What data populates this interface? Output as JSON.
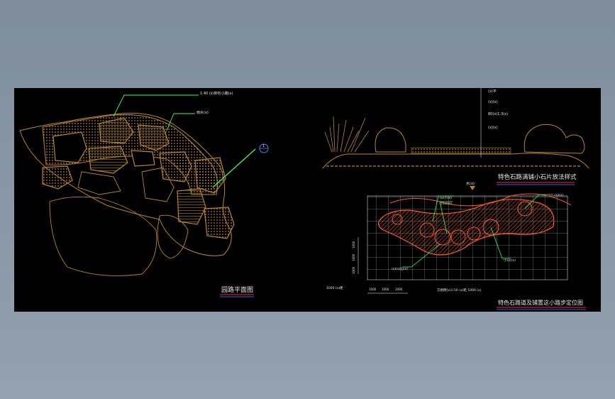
{
  "colors": {
    "background": "#000000",
    "plan_stroke": "#b8862a",
    "path_red": "#ff5a2a",
    "leader_green": "#39ff4a",
    "grid": "#ffffff",
    "title_underline_red": "#ff2a2a",
    "title_underline_blue": "#3a5bff",
    "text": "#e8e8e8"
  },
  "left_plan": {
    "title": "园路平面图",
    "callout_top": "1:40 (x)卵石小路(x)",
    "callout_mid": "雨水(x)",
    "section_marker": "1"
  },
  "section_view": {
    "title": "特色石路满铺小石片放法样式",
    "labels": [
      "(x)平",
      "(x)(x)",
      "80(x)1:3(x)",
      "(x)(x)"
    ]
  },
  "grid_plan": {
    "title": "特色石路道及铺置这小路步定位图",
    "top_tag": "水(x)",
    "callout_a": "(x)小(x)",
    "callout_b": "小(x)(x)",
    "callout_c": "(x)(x)",
    "callout_d": "小(x)(x)",
    "callout_e": "(x)(x)石(x)",
    "scale_note": "方格网(x)1:50 (x)距 1000 (x)",
    "dim_left": [
      "1000",
      "1000",
      "1000"
    ],
    "dim_bottom": [
      "1000",
      "1000",
      "1000"
    ],
    "bottom_left_note": "1000 (x)距"
  }
}
